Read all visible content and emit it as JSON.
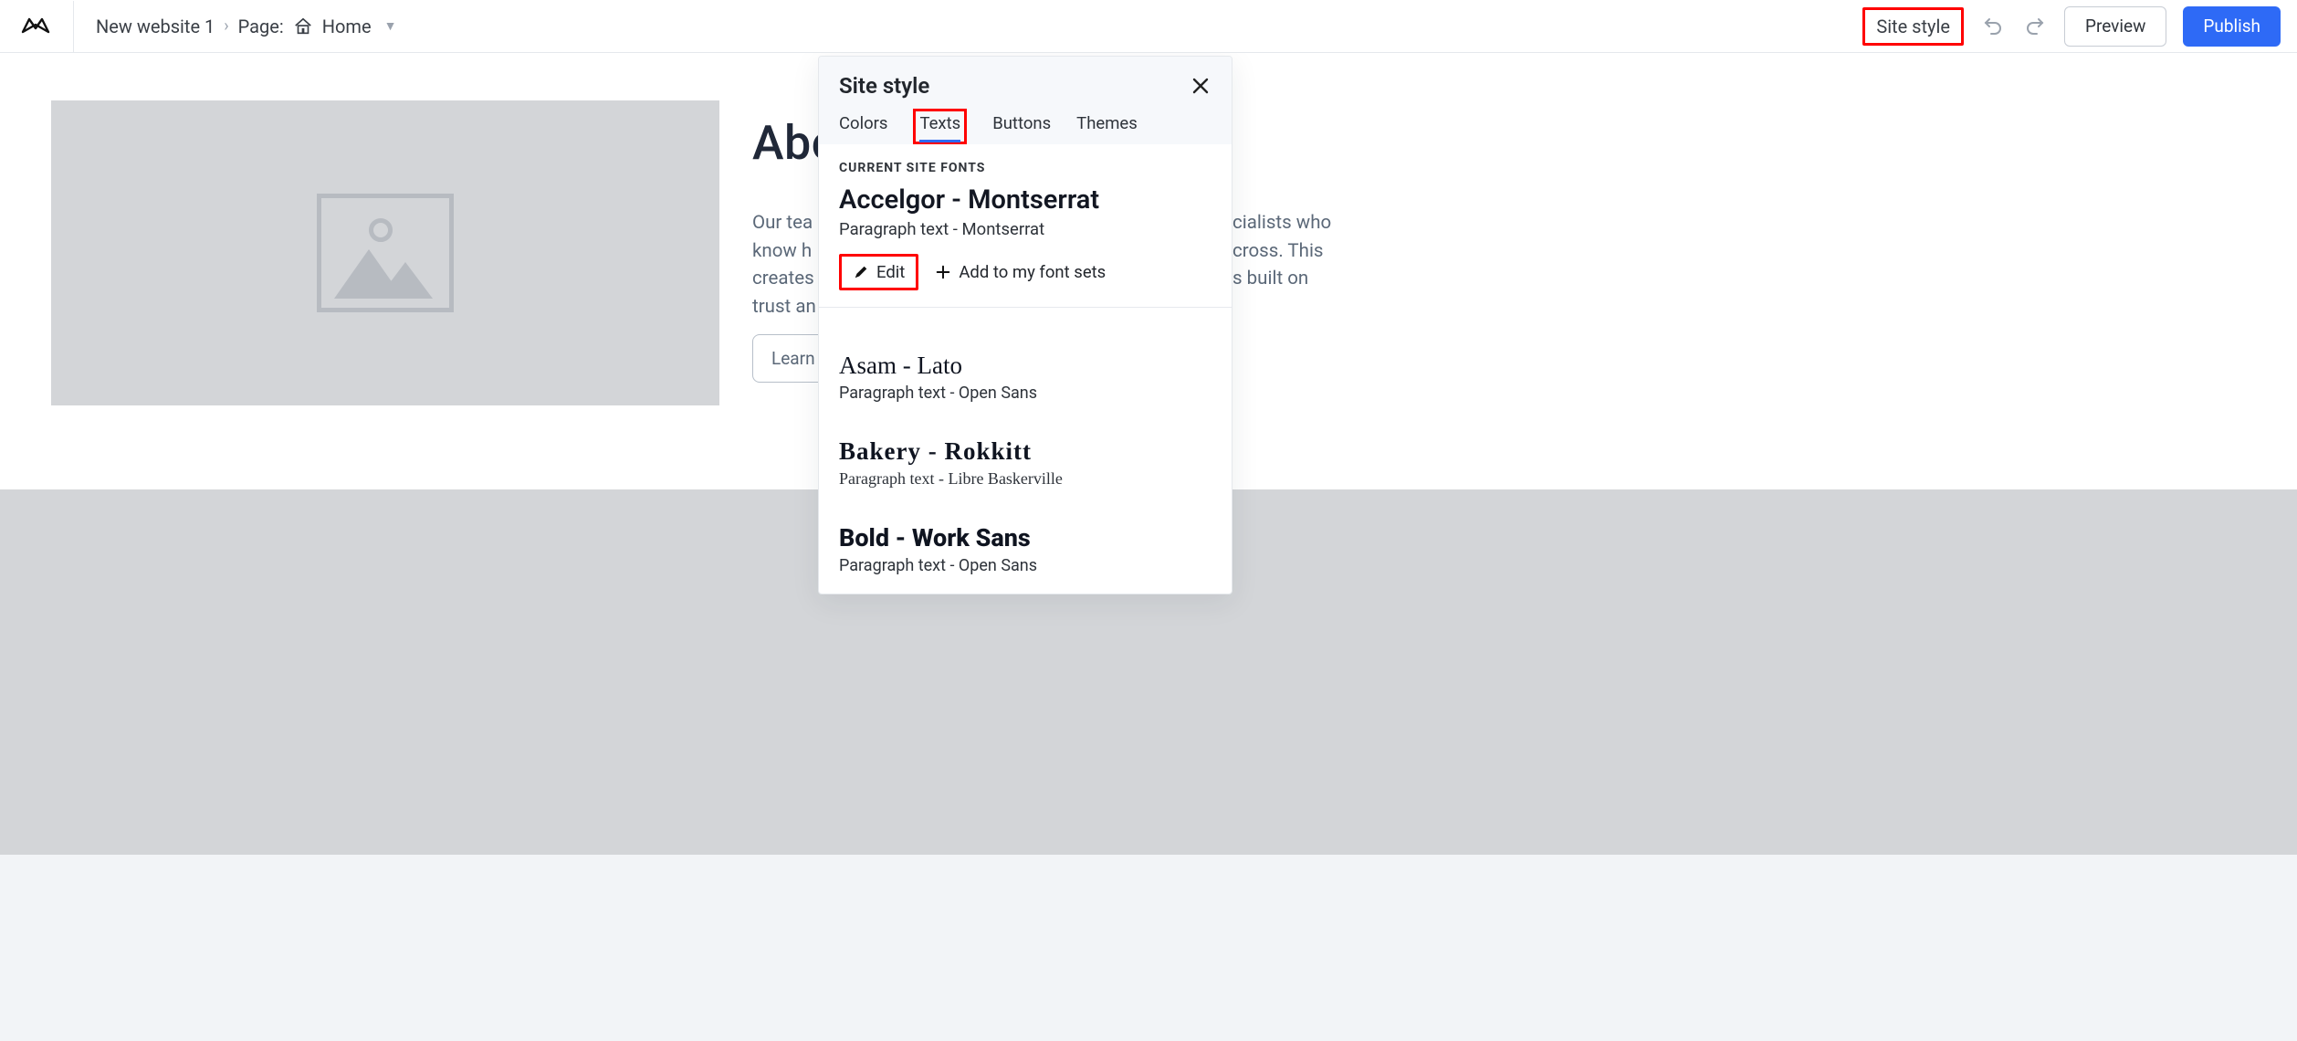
{
  "topbar": {
    "website_name": "New website 1",
    "page_label": "Page:",
    "page_name": "Home",
    "site_style": "Site style",
    "preview": "Preview",
    "publish": "Publish"
  },
  "canvas": {
    "heading": "Abc",
    "paragraph_left": "Our tea\nknow h\ncreates\ntrust an",
    "paragraph_right": "cialists who\ncross. This\ns built on",
    "learn_button": "Learn"
  },
  "panel": {
    "title": "Site style",
    "tabs": {
      "colors": "Colors",
      "texts": "Texts",
      "buttons": "Buttons",
      "themes": "Themes"
    },
    "section_label": "CURRENT SITE FONTS",
    "current": {
      "heading": "Accelgor - Montserrat",
      "paragraph": "Paragraph text - Montserrat"
    },
    "edit": "Edit",
    "add": "Add to my font sets",
    "fonts": [
      {
        "heading": "Asam - Lato",
        "paragraph": "Paragraph text - Open Sans",
        "style": "serif"
      },
      {
        "heading": "Bakery - Rokkitt",
        "paragraph": "Paragraph text - Libre Baskerville",
        "style": "slab"
      },
      {
        "heading": "Bold - Work Sans",
        "paragraph": "Paragraph text - Open Sans",
        "style": "sans-bold"
      }
    ]
  },
  "highlights": {
    "color": "#ff0000"
  }
}
